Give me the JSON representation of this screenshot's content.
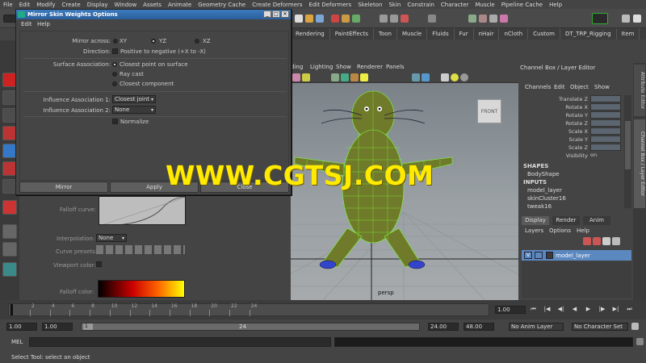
{
  "menubar": [
    "File",
    "Edit",
    "Modify",
    "Create",
    "Display",
    "Window",
    "Assets",
    "Animate",
    "Geometry Cache",
    "Create Deformers",
    "Edit Deformers",
    "Skeleton",
    "Skin",
    "Constrain",
    "Character",
    "Muscle",
    "Pipeline Cache",
    "Help"
  ],
  "shelf_tabs": [
    "Rendering",
    "PaintEffects",
    "Toon",
    "Muscle",
    "Fluids",
    "Fur",
    "nHair",
    "nCloth",
    "Custom",
    "DT_TRP_Rigging",
    "Item"
  ],
  "dialog": {
    "title": "Mirror Skin Weights Options",
    "menu": [
      "Edit",
      "Help"
    ],
    "mirror_across_label": "Mirror across:",
    "mirror_options": [
      "XY",
      "YZ",
      "XZ"
    ],
    "mirror_selected": "YZ",
    "direction_label": "Direction:",
    "direction_text": "Positive to negative (+X to -X)",
    "surface_assoc_label": "Surface Association:",
    "surface_options": [
      "Closest point on surface",
      "Ray cast",
      "Closest component"
    ],
    "influence1_label": "Influence Association 1:",
    "influence1_value": "Closest joint",
    "influence2_label": "Influence Association 2:",
    "influence2_value": "None",
    "normalize_label": "Normalize",
    "buttons": {
      "mirror": "Mirror",
      "apply": "Apply",
      "close": "Close"
    }
  },
  "toolpanel": {
    "falloff_curve_label": "Falloff curve:",
    "interpolation_label": "Interpolation:",
    "interpolation_value": "None",
    "curve_presets_label": "Curve presets:",
    "viewport_color_label": "Viewport color:",
    "falloff_color_label": "Falloff color:"
  },
  "viewport": {
    "menu": [
      "ding",
      "Lighting",
      "Show",
      "Renderer",
      "Panels"
    ],
    "camera_label": "persp",
    "viewcube_label": "FRONT"
  },
  "channelbox": {
    "title": "Channel Box / Layer Editor",
    "menu": [
      "Channels",
      "Edit",
      "Object",
      "Show"
    ],
    "attrs": [
      "Translate Z",
      "Rotate X",
      "Rotate Y",
      "Rotate Z",
      "Scale X",
      "Scale Y",
      "Scale Z",
      "Visibility"
    ],
    "visibility_value": "on",
    "shapes_header": "SHAPES",
    "shape_name": "BodyShape",
    "inputs_header": "INPUTS",
    "inputs": [
      "model_layer",
      "skinCluster16",
      "tweak16"
    ]
  },
  "layereditor": {
    "tabs": [
      "Display",
      "Render",
      "Anim"
    ],
    "active_tab": "Display",
    "menu": [
      "Layers",
      "Options",
      "Help"
    ],
    "layer_v": "V",
    "layer_name": "model_layer"
  },
  "side_tabs": [
    "Attribute Editor",
    "Channel Box / Layer Editor"
  ],
  "timeslider": {
    "ticks": [
      "2",
      "4",
      "6",
      "8",
      "10",
      "12",
      "14",
      "16",
      "18",
      "20",
      "22",
      "24"
    ],
    "current_frame": "1.00"
  },
  "rangeslider": {
    "start": "1.00",
    "start2": "1.00",
    "range_start": "1",
    "range_end": "24",
    "end": "24.00",
    "end2": "48.00",
    "anim_layer": "No Anim Layer",
    "character_set": "No Character Set"
  },
  "cmdline": {
    "label": "MEL"
  },
  "helpline": {
    "text": "Select Tool: select an object"
  },
  "watermark": "WWW.CGTSJ.COM",
  "colors": {
    "accent": "#2a5e9a",
    "wireframe": "#7dff3a",
    "watermark": "#ffea00",
    "selected_layer": "#5c88c0"
  }
}
